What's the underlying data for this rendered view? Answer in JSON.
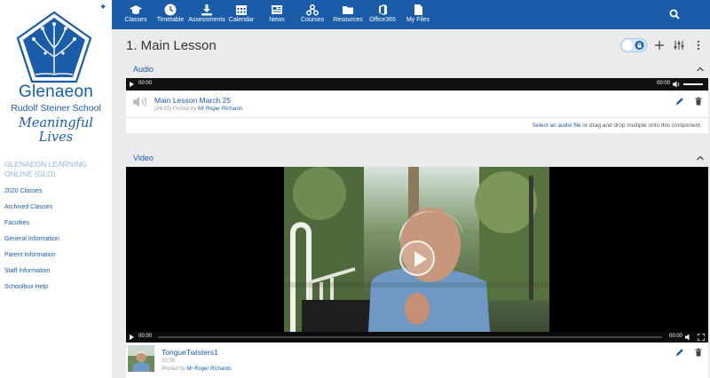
{
  "sidebar": {
    "brand_name": "Glenaeon",
    "brand_sub": "Rudolf Steiner School",
    "brand_tagline": "Meaningful Lives",
    "heading": "GLENAEON LEARNING ONLINE (GLO)",
    "items": [
      {
        "label": "2020 Classes"
      },
      {
        "label": "Archived Classes"
      },
      {
        "label": "Faculties"
      },
      {
        "label": "General Information"
      },
      {
        "label": "Parent Information"
      },
      {
        "label": "Staff Information"
      },
      {
        "label": "Schoolbox Help"
      }
    ]
  },
  "topnav": {
    "items": [
      {
        "label": "Classes",
        "icon": "mortarboard-icon"
      },
      {
        "label": "Timetable",
        "icon": "clock-icon"
      },
      {
        "label": "Assessments",
        "icon": "download-icon"
      },
      {
        "label": "Calendar",
        "icon": "calendar-icon"
      },
      {
        "label": "News",
        "icon": "newspaper-icon"
      },
      {
        "label": "Courses",
        "icon": "network-icon"
      },
      {
        "label": "Resources",
        "icon": "folder-icon"
      },
      {
        "label": "Office365",
        "icon": "office-icon"
      },
      {
        "label": "My Files",
        "icon": "files-icon"
      }
    ]
  },
  "page": {
    "title": "1. Main Lesson"
  },
  "audio_section": {
    "title": "Audio",
    "player": {
      "current": "00:00",
      "duration": "00:00"
    },
    "item": {
      "title": "Main Lesson March 25",
      "duration": "(24:55)",
      "posted_by_label": "Posted by",
      "author": "Mr Roger Richards"
    },
    "select_link": "Select an audio file",
    "select_rest": " or drag and drop multiple onto this component"
  },
  "video_section": {
    "title": "Video",
    "player": {
      "current": "00:00",
      "duration": "00:00"
    },
    "item": {
      "title": "TongueTwisters1",
      "duration": "02:06",
      "posted_by_label": "Posted by",
      "author": "Mr Roger Richards"
    }
  },
  "colors": {
    "brand": "#1a5ca8",
    "background": "#ebebeb",
    "player": "#111111"
  }
}
